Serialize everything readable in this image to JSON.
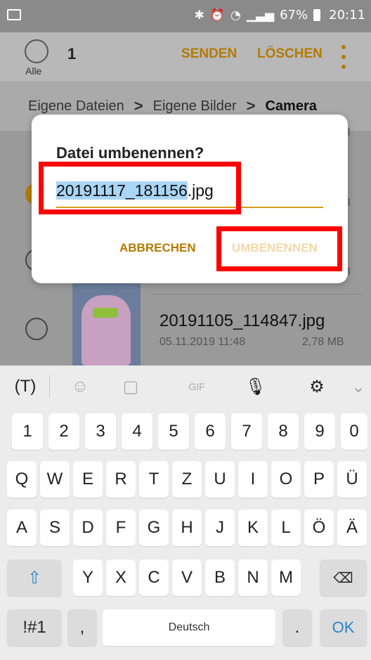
{
  "status_bar": {
    "battery": "67%",
    "time": "20:11",
    "icons": [
      "image-icon",
      "bluetooth-icon",
      "alarm-icon",
      "wifi-icon",
      "signal-icon",
      "battery-icon"
    ]
  },
  "app_bar": {
    "select_all_label": "Alle",
    "selected_count": "1",
    "send_label": "SENDEN",
    "delete_label": "LÖSCHEN"
  },
  "breadcrumb": {
    "items": [
      "Eigene Dateien",
      "Eigene Bilder",
      "Camera"
    ]
  },
  "file_list": {
    "partial_digit": "3",
    "file": {
      "name": "20191105_114847.jpg",
      "date": "05.11.2019 11:48",
      "size": "2,78 MB"
    }
  },
  "dialog": {
    "title": "Datei umbenennen?",
    "name_selected": "20191117_181156",
    "name_ext": ".jpg",
    "cancel_label": "ABBRECHEN",
    "rename_label": "UMBENENNEN"
  },
  "keyboard": {
    "toolbar": [
      "text-recognition-icon",
      "emoji-icon",
      "sticker-icon",
      "gif-icon",
      "microphone-icon",
      "settings-icon",
      "collapse-icon"
    ],
    "row1": [
      "1",
      "2",
      "3",
      "4",
      "5",
      "6",
      "7",
      "8",
      "9",
      "0"
    ],
    "row2": [
      "Q",
      "W",
      "E",
      "R",
      "T",
      "Z",
      "U",
      "I",
      "O",
      "P",
      "Ü"
    ],
    "row3": [
      "A",
      "S",
      "D",
      "F",
      "G",
      "H",
      "J",
      "K",
      "L",
      "Ö",
      "Ä"
    ],
    "row4": [
      "Y",
      "X",
      "C",
      "V",
      "B",
      "N",
      "M"
    ],
    "symbols_label": "!#1",
    "comma_label": ",",
    "space_label": "Deutsch",
    "period_label": ".",
    "ok_label": "OK"
  },
  "colors": {
    "accent": "#b37b00",
    "highlight": "#ff0000",
    "selection": "#a9d6f5",
    "keyboard_ok": "#2a84c6"
  }
}
